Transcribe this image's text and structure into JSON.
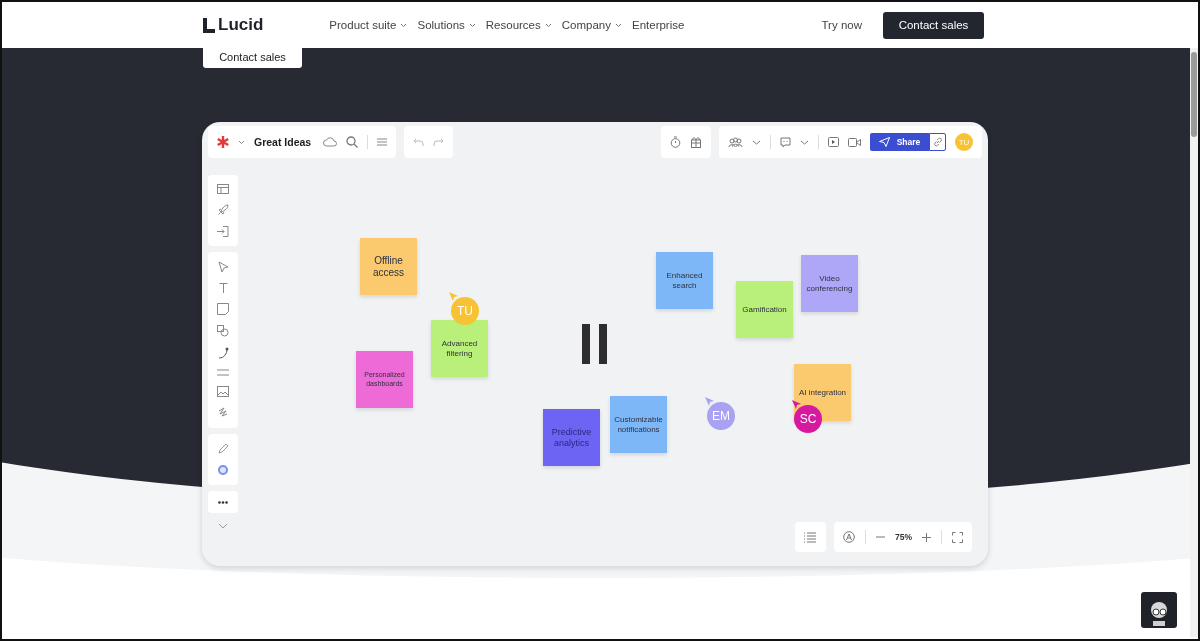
{
  "nav": {
    "logo": "Lucid",
    "menu": [
      {
        "label": "Product suite",
        "dropdown": true
      },
      {
        "label": "Solutions",
        "dropdown": true
      },
      {
        "label": "Resources",
        "dropdown": true
      },
      {
        "label": "Company",
        "dropdown": true
      },
      {
        "label": "Enterprise",
        "dropdown": false
      }
    ],
    "try_now": "Try now",
    "contact_sales": "Contact sales"
  },
  "floating_button": "Contact sales",
  "app": {
    "title": "Great Ideas",
    "share": "Share",
    "avatar": "TU",
    "zoom": "75%",
    "notes": [
      {
        "text": "Offline access",
        "color": "#fbc96e"
      },
      {
        "text": "Advanced filtering",
        "color": "#b9f079"
      },
      {
        "text": "Personalized dashboards",
        "color": "#ee6ad6"
      },
      {
        "text": "Enhanced search",
        "color": "#7db7f8"
      },
      {
        "text": "Gamification",
        "color": "#b9f079"
      },
      {
        "text": "Video conferencing",
        "color": "#aea6f7"
      },
      {
        "text": "AI integration",
        "color": "#fbc96e"
      },
      {
        "text": "Predictive analytics",
        "color": "#6e64f4"
      },
      {
        "text": "Customizable notifications",
        "color": "#7db7f8"
      }
    ],
    "cursors": [
      {
        "initials": "TU",
        "color": "#f7c234"
      },
      {
        "initials": "EM",
        "color": "#a9a2f2"
      },
      {
        "initials": "SC",
        "color": "#d6199e"
      }
    ]
  }
}
